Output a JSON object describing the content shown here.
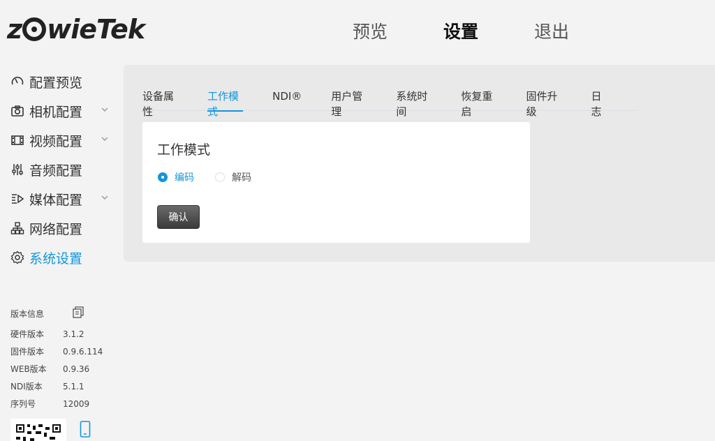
{
  "brand": {
    "logo_text_left": "z",
    "logo_text_right": "wieTek"
  },
  "topnav": [
    {
      "label": "预览",
      "active": false
    },
    {
      "label": "设置",
      "active": true
    },
    {
      "label": "退出",
      "active": false
    }
  ],
  "sidebar": {
    "items": [
      {
        "label": "配置预览",
        "icon": "dashboard-icon",
        "has_chevron": false,
        "active": false
      },
      {
        "label": "相机配置",
        "icon": "camera-icon",
        "has_chevron": true,
        "active": false
      },
      {
        "label": "视频配置",
        "icon": "film-icon",
        "has_chevron": true,
        "active": false
      },
      {
        "label": "音频配置",
        "icon": "sliders-icon",
        "has_chevron": false,
        "active": false
      },
      {
        "label": "媒体配置",
        "icon": "media-icon",
        "has_chevron": true,
        "active": false
      },
      {
        "label": "网络配置",
        "icon": "network-icon",
        "has_chevron": false,
        "active": false
      },
      {
        "label": "系统设置",
        "icon": "gear-icon",
        "has_chevron": false,
        "active": true
      }
    ]
  },
  "version": {
    "title": "版本信息",
    "rows": [
      {
        "key": "硬件版本",
        "value": "3.1.2"
      },
      {
        "key": "固件版本",
        "value": "0.9.6.114"
      },
      {
        "key": "WEB版本",
        "value": "0.9.36"
      },
      {
        "key": "NDI版本",
        "value": "5.1.1"
      },
      {
        "key": "序列号",
        "value": "12009"
      }
    ]
  },
  "tabs": [
    {
      "label": "设备属性",
      "active": false
    },
    {
      "label": "工作模式",
      "active": true
    },
    {
      "label": "NDI®",
      "active": false
    },
    {
      "label": "用户管理",
      "active": false
    },
    {
      "label": "系统时间",
      "active": false
    },
    {
      "label": "恢复重启",
      "active": false
    },
    {
      "label": "固件升级",
      "active": false
    },
    {
      "label": "日志",
      "active": false
    }
  ],
  "card": {
    "title": "工作模式",
    "options": [
      {
        "label": "编码",
        "checked": true
      },
      {
        "label": "解码",
        "checked": false
      }
    ],
    "confirm_label": "确认"
  },
  "colors": {
    "accent": "#1296db",
    "panel_bg": "#e9e9e9",
    "page_bg": "#f3f3f3"
  }
}
